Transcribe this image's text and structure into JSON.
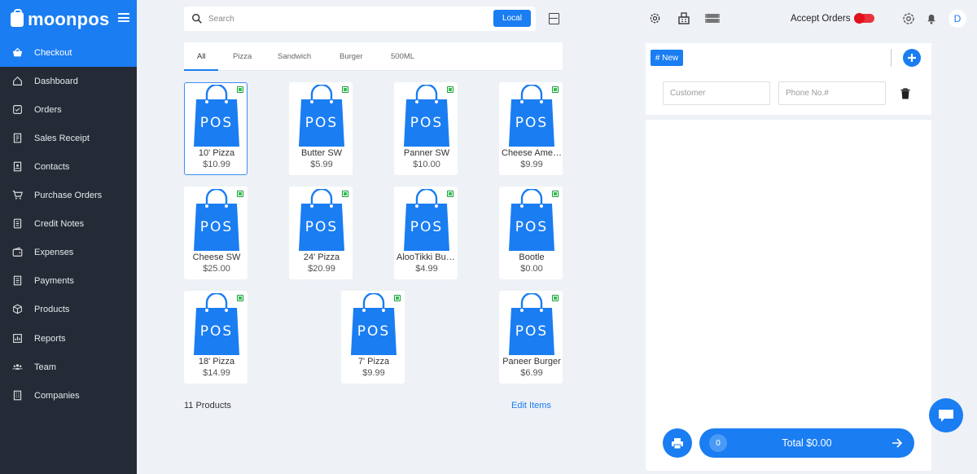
{
  "brand": {
    "name": "moonpos"
  },
  "sidebar": {
    "items": [
      {
        "label": "Checkout",
        "icon": "basket-icon"
      },
      {
        "label": "Dashboard",
        "icon": "home-icon"
      },
      {
        "label": "Orders",
        "icon": "check-square-icon"
      },
      {
        "label": "Sales Receipt",
        "icon": "receipt-icon"
      },
      {
        "label": "Contacts",
        "icon": "contacts-icon"
      },
      {
        "label": "Purchase Orders",
        "icon": "cart-icon"
      },
      {
        "label": "Credit Notes",
        "icon": "note-icon"
      },
      {
        "label": "Expenses",
        "icon": "wallet-icon"
      },
      {
        "label": "Payments",
        "icon": "payments-icon"
      },
      {
        "label": "Products",
        "icon": "box-icon"
      },
      {
        "label": "Reports",
        "icon": "chart-icon"
      },
      {
        "label": "Team",
        "icon": "team-icon"
      },
      {
        "label": "Companies",
        "icon": "building-icon"
      }
    ]
  },
  "search": {
    "placeholder": "Search",
    "mode_button": "Local"
  },
  "categories": [
    "All",
    "Pizza",
    "Sandwich",
    "Burger",
    "500ML"
  ],
  "products": [
    {
      "name": "10' Pizza",
      "price": "$10.99",
      "image_text": "POS"
    },
    {
      "name": "Butter SW",
      "price": "$5.99",
      "image_text": "POS"
    },
    {
      "name": "Panner SW",
      "price": "$10.00",
      "image_text": "POS"
    },
    {
      "name": "Cheese American",
      "price": "$9.99",
      "image_text": "POS"
    },
    {
      "name": "Cheese SW",
      "price": "$25.00",
      "image_text": "POS"
    },
    {
      "name": "24' Pizza",
      "price": "$20.99",
      "image_text": "POS"
    },
    {
      "name": "AlooTikki Burger",
      "price": "$4.99",
      "image_text": "POS"
    },
    {
      "name": "Bootle",
      "price": "$0.00",
      "image_text": "POS"
    },
    {
      "name": "18' Pizza",
      "price": "$14.99",
      "image_text": "POS"
    },
    {
      "name": "7' Pizza",
      "price": "$9.99",
      "image_text": "POS"
    },
    {
      "name": "Paneer Burger",
      "price": "$6.99",
      "image_text": "POS"
    }
  ],
  "footer": {
    "product_count": "11 Products",
    "edit_items": "Edit Items"
  },
  "header": {
    "accept_orders_label": "Accept Orders",
    "accept_orders_on": false,
    "avatar_initial": "D"
  },
  "cart": {
    "new_button": "# New",
    "customer_placeholder": "Customer",
    "phone_placeholder": "Phone No.#",
    "item_count": "0",
    "total_label": "Total $0.00"
  },
  "colors": {
    "accent": "#1a7df2",
    "sidebar": "#252b36",
    "toggle_off": "#e0101c",
    "veg_badge": "#2bc24a"
  }
}
